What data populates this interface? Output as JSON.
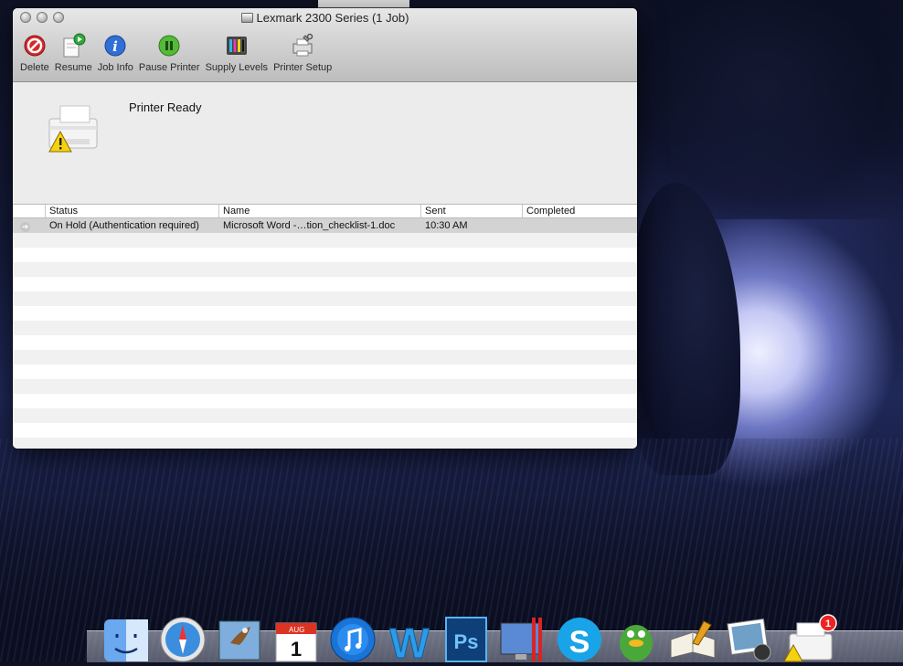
{
  "window": {
    "title": "Lexmark 2300 Series (1 Job)"
  },
  "toolbar": {
    "items": [
      {
        "label": "Delete",
        "icon": "delete-icon"
      },
      {
        "label": "Resume",
        "icon": "resume-icon"
      },
      {
        "label": "Job Info",
        "icon": "info-icon"
      },
      {
        "label": "Pause Printer",
        "icon": "pause-icon"
      },
      {
        "label": "Supply Levels",
        "icon": "ink-levels-icon"
      },
      {
        "label": "Printer Setup",
        "icon": "printer-setup-icon"
      }
    ]
  },
  "printer": {
    "status": "Printer Ready"
  },
  "jobs": {
    "columns": [
      "Status",
      "Name",
      "Sent",
      "Completed"
    ],
    "rows": [
      {
        "status": "On Hold (Authentication required)",
        "name": "Microsoft Word -…tion_checklist-1.doc",
        "sent": "10:30 AM",
        "completed": ""
      }
    ]
  },
  "dock": {
    "items": [
      "finder-icon",
      "safari-icon",
      "mail-icon",
      "calendar-icon",
      "itunes-icon",
      "word-icon",
      "photoshop-icon",
      "parallels-icon",
      "skype-icon",
      "adium-icon",
      "preview-icon",
      "iphoto-icon",
      "printer-queue-icon"
    ],
    "calendar_month": "AUG",
    "calendar_day": "1",
    "printer_badge": "1"
  }
}
